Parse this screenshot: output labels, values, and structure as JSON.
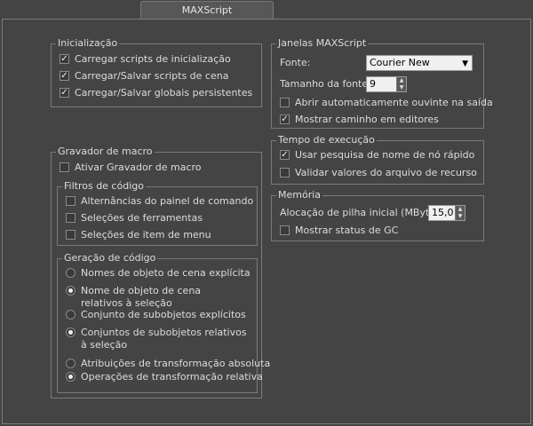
{
  "tab": {
    "label": "MAXScript"
  },
  "startup": {
    "title": "Inicialização",
    "items": [
      {
        "label": "Carregar scripts de inicialização",
        "checked": true
      },
      {
        "label": "Carregar/Salvar scripts de cena",
        "checked": true
      },
      {
        "label": "Carregar/Salvar globais persistentes",
        "checked": true
      }
    ]
  },
  "macro_recorder": {
    "title": "Gravador de macro",
    "enable": {
      "label": "Ativar Gravador de macro",
      "checked": false
    },
    "code_filters": {
      "title": "Filtros de código",
      "items": [
        {
          "label": "Alternâncias do painel de comando",
          "checked": false
        },
        {
          "label": "Seleções de ferramentas",
          "checked": false
        },
        {
          "label": "Seleções de item de menu",
          "checked": false
        }
      ]
    },
    "code_generation": {
      "title": "Geração de código",
      "items": [
        {
          "label": "Nomes de objeto de cena explícita",
          "selected": false
        },
        {
          "label": "Nome de objeto de cena relativos à seleção",
          "selected": true
        },
        {
          "label": "Conjunto de subobjetos explícitos",
          "selected": false
        },
        {
          "label": "Conjuntos de subobjetos relativos à seleção",
          "selected": true
        },
        {
          "label": "Atribuições de transformação absoluta",
          "selected": false
        },
        {
          "label": "Operações de transformação relativa",
          "selected": true
        }
      ]
    }
  },
  "windows": {
    "title": "Janelas MAXScript",
    "font_label": "Fonte:",
    "font_value": "Courier New",
    "font_size_label": "Tamanho da fonte:",
    "font_size_value": "9",
    "auto_open": {
      "label": "Abrir automaticamente ouvinte na saída",
      "checked": false
    },
    "show_path": {
      "label": "Mostrar caminho em editores",
      "checked": true
    }
  },
  "runtime": {
    "title": "Tempo de execução",
    "fast_node": {
      "label": "Usar pesquisa de nome de nó rápido",
      "checked": true
    },
    "validate": {
      "label": "Validar valores do arquivo de recurso",
      "checked": false
    }
  },
  "memory": {
    "title": "Memória",
    "stack_label": "Alocação de pilha inicial (MBytes):",
    "stack_value": "15,0",
    "show_gc": {
      "label": "Mostrar status de GC",
      "checked": false
    }
  }
}
